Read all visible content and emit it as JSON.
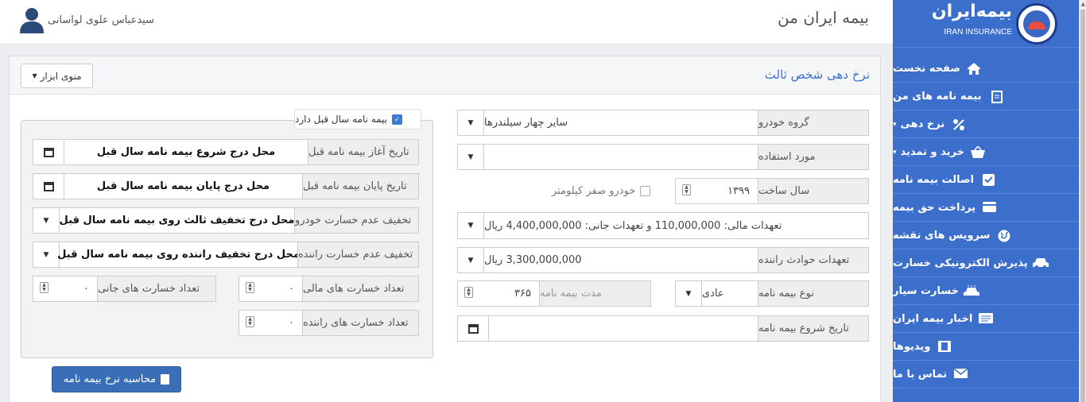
{
  "header": {
    "app_title": "بیمه ایران من",
    "user_name": "سیدعباس علوی لواسانی"
  },
  "brand": {
    "name_fa": "بیمه‌ایران",
    "name_en": "IRAN INSURANCE"
  },
  "sidebar": {
    "items": [
      {
        "label": "صفحه نخست",
        "icon": "home-icon"
      },
      {
        "label": "بیمه نامه های من",
        "icon": "document-icon"
      },
      {
        "label": "نرخ دهی",
        "icon": "percent-icon",
        "caret": "▾"
      },
      {
        "label": "خرید و تمدید",
        "icon": "basket-icon",
        "caret": "▾"
      },
      {
        "label": "اصالت بیمه نامه",
        "icon": "check-square-icon"
      },
      {
        "label": "پرداخت حق بیمه",
        "icon": "credit-card-icon"
      },
      {
        "label": "سرویس های نقشه",
        "icon": "globe-icon"
      },
      {
        "label": "پذیرش الکترونیکی خسارت",
        "icon": "car-icon"
      },
      {
        "label": "خسارت سیار",
        "icon": "car-wash-icon"
      },
      {
        "label": "اخبار بیمه ایران",
        "icon": "newspaper-icon"
      },
      {
        "label": "ویدیوها",
        "icon": "film-icon"
      },
      {
        "label": "تماس با ما",
        "icon": "envelope-icon"
      }
    ]
  },
  "panel": {
    "title": "نرخ دهی شخص ثالث",
    "tools_label": "منوی ابزار"
  },
  "form": {
    "vehicle_group": {
      "label": "گروه خودرو",
      "value": "سایر چهار سیلندرها"
    },
    "usage": {
      "label": "مورد استفاده",
      "value": ""
    },
    "build_year": {
      "label": "سال ساخت",
      "value": "۱۳۹۹"
    },
    "zero_km": {
      "label": "خودرو صفر کیلومتر",
      "checked": false
    },
    "obligations": {
      "value": "تعهدات مالی: 110,000,000 و تعهدات جانی: 4,400,000,000 ریال"
    },
    "driver_accident": {
      "label": "تعهدات حوادث راننده",
      "value": "3,300,000,000 ریال"
    },
    "policy_type": {
      "label": "نوع بیمه نامه",
      "value": "عادی"
    },
    "policy_duration": {
      "label": "مدت بیمه نامه",
      "value": "۳۶۵"
    },
    "policy_start": {
      "label": "تاریخ شروع بیمه نامه",
      "value": ""
    }
  },
  "prev": {
    "legend": "بیمه نامه سال قبل دارد",
    "checked": true,
    "start_date": {
      "label": "تاریخ آغاز بیمه نامه قبل",
      "value": "محل درج شروع بیمه نامه سال قبل"
    },
    "end_date": {
      "label": "تاریخ پایان بیمه نامه قبل",
      "value": "محل درج پایان بیمه نامه سال قبل"
    },
    "vehicle_discount": {
      "label": "تخفیف عدم خسارت خودرو",
      "value": "محل درج تخفیف ثالث روی بیمه نامه سال قبل"
    },
    "driver_discount": {
      "label": "تخفیف عدم خسارت راننده",
      "value": "محل درج تخفیف راننده روی بیمه نامه سال قبل"
    },
    "bodily_claims": {
      "label": "تعداد خسارت های جانی",
      "value": "۰"
    },
    "financial_claims": {
      "label": "تعداد خسارت های مالی",
      "value": "۰"
    },
    "driver_claims": {
      "label": "تعداد خسارت های راننده",
      "value": "۰"
    }
  },
  "calc_button": "محاسبه نرخ بیمه نامه",
  "colors": {
    "sidebar": "#3c6fcc",
    "title": "#3c6fcc",
    "button": "#3a6fb8"
  }
}
